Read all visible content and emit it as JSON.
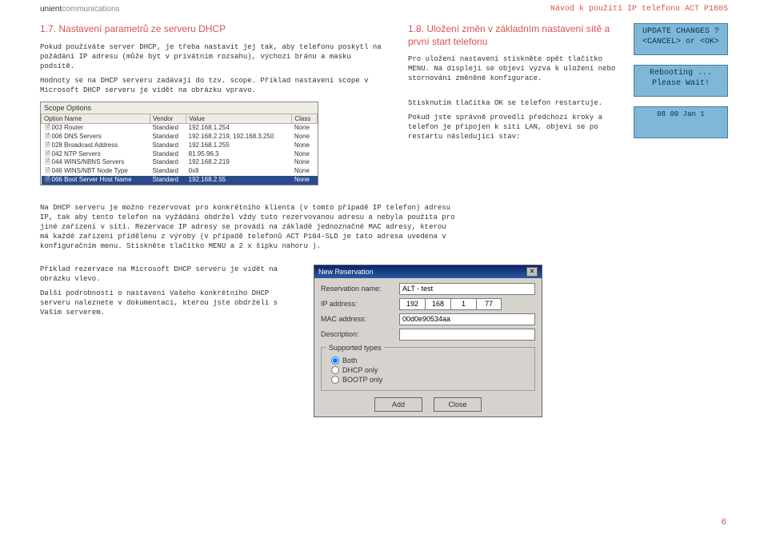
{
  "header": {
    "brand_strong": "unient",
    "brand_light": "communications",
    "doc_title": "Návod k použití IP telefonu ACT P160S"
  },
  "sec17": {
    "title": "1.7. Nastavení parametrů ze serveru DHCP",
    "p1": "Pokud používáte server DHCP, je třeba nastavit jej tak, aby telefonu poskytl na požádání IP adresu (může být v privátním rozsahu), výchozí bránu a masku podsítě.",
    "p2": "Hodnoty se na DHCP serveru zadávají do tzv. scope. Příklad nastavení scope v Microsoft DHCP serveru je vidět na obrázku vpravo."
  },
  "sec18": {
    "title": "1.8. Uložení změn v základním nastavení sítě a první start telefonu",
    "p1": "Pro uložení nastavení stiskněte opět tlačítko MENU. Na displeji se objeví výzva k uložení nebo stornování změněné konfigurace.",
    "p2": "Stisknutím tlačítka OK se telefon restartuje.",
    "p3": "Pokud jste správně provedli předchozí kroky a telefon je připojen k síti LAN, objeví se po restartu následující stav:"
  },
  "lcd": {
    "d1": "UPDATE CHANGES ?\n<CANCEL> or <OK>",
    "d2": "Rebooting ...\nPlease Wait!",
    "d3": "08 00   Jan  1"
  },
  "scope": {
    "panel_title": "Scope Options",
    "cols": [
      "Option Name",
      "Vendor",
      "Value",
      "Class"
    ],
    "rows": [
      {
        "name": "003 Router",
        "vendor": "Standard",
        "value": "192.168.1.254",
        "cls": "None"
      },
      {
        "name": "006 DNS Servers",
        "vendor": "Standard",
        "value": "192.168.2.219, 192.168.3.250",
        "cls": "None"
      },
      {
        "name": "028 Broadcast Address",
        "vendor": "Standard",
        "value": "192.168.1.255",
        "cls": "None"
      },
      {
        "name": "042 NTP Servers",
        "vendor": "Standard",
        "value": "81.95.96.3",
        "cls": "None"
      },
      {
        "name": "044 WINS/NBNS Servers",
        "vendor": "Standard",
        "value": "192.168.2.219",
        "cls": "None"
      },
      {
        "name": "046 WINS/NBT Node Type",
        "vendor": "Standard",
        "value": "0x8",
        "cls": "None"
      },
      {
        "name": "066 Boot Server Host Name",
        "vendor": "Standard",
        "value": "192.168.2.55",
        "cls": "None"
      }
    ]
  },
  "dhcp_text": {
    "p1": "Na DHCP serveru je možno rezervovat pro konkrétního klienta (v tomto případě IP telefon) adresu IP, tak aby tento telefon na vyžádání obdržel vždy tuto rezervovanou adresu a nebyla použita pro jiné zařízení v síti. Rezervace IP adresy se provádí na základě jednoznačné MAC adresy, kterou má každé zařízení přidělenu z výroby (v případě telefonů ACT P104-SLD je tato adresa uvedena v konfiguračním menu. Stiskněte tlačítko MENU a 2 x šipku nahoru )."
  },
  "reservation_left": {
    "p1": "Příklad rezervace na Microsoft DHCP serveru  je vidět na obrázku vlevo.",
    "p2": "Další podrobnosti o nastavení Vašeho konkrétního DHCP serveru naleznete v dokumentaci, kterou jste obdrželi s Vaším serverem."
  },
  "nr": {
    "title": "New Reservation",
    "close_glyph": "✕",
    "labels": {
      "name": "Reservation name:",
      "ip": "IP address:",
      "mac": "MAC address:",
      "desc": "Description:",
      "types": "Supported types",
      "both": "Both",
      "dhcp": "DHCP only",
      "bootp": "BOOTP only"
    },
    "values": {
      "name": "ALT - test",
      "ip": [
        "192",
        "168",
        "1",
        "77"
      ],
      "mac": "00d0e90534aa",
      "desc": ""
    },
    "buttons": {
      "add": "Add",
      "close": "Close"
    }
  },
  "page_number": "6",
  "chart_data": {
    "type": "table",
    "title": "Scope Options",
    "columns": [
      "Option Name",
      "Vendor",
      "Value",
      "Class"
    ],
    "rows": [
      [
        "003 Router",
        "Standard",
        "192.168.1.254",
        "None"
      ],
      [
        "006 DNS Servers",
        "Standard",
        "192.168.2.219, 192.168.3.250",
        "None"
      ],
      [
        "028 Broadcast Address",
        "Standard",
        "192.168.1.255",
        "None"
      ],
      [
        "042 NTP Servers",
        "Standard",
        "81.95.96.3",
        "None"
      ],
      [
        "044 WINS/NBNS Servers",
        "Standard",
        "192.168.2.219",
        "None"
      ],
      [
        "046 WINS/NBT Node Type",
        "Standard",
        "0x8",
        "None"
      ],
      [
        "066 Boot Server Host Name",
        "Standard",
        "192.168.2.55",
        "None"
      ]
    ]
  }
}
